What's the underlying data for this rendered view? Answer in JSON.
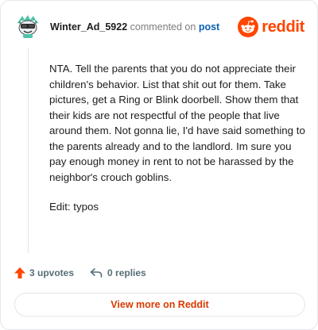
{
  "comment": {
    "author": "Winter_Ad_5922",
    "action_text": "commented on",
    "post_link": "post",
    "paragraphs": [
      "NTA. Tell the parents that you do not appreciate their children's behavior. List that shit out for them. Take pictures, get a Ring or Blink doorbell. Show them that their kids are not respectful of the people that live around them. Not gonna lie, I'd have said something to the parents already and to the landlord. Im sure you pay enough money in rent to not be harassed by the neighbor's crouch goblins.",
      "Edit: typos"
    ],
    "upvotes": "3 upvotes",
    "replies": "0 replies"
  },
  "brand": {
    "logo_text": "reddit",
    "logo_icon": "reddit-snoo-icon",
    "accent": "#ff4500"
  },
  "footer": {
    "view_more_label": "View more on Reddit"
  },
  "icons": {
    "avatar": "snoo-avatar-icon",
    "upvote": "upvote-arrow-icon",
    "reply": "reply-arrow-icon"
  }
}
